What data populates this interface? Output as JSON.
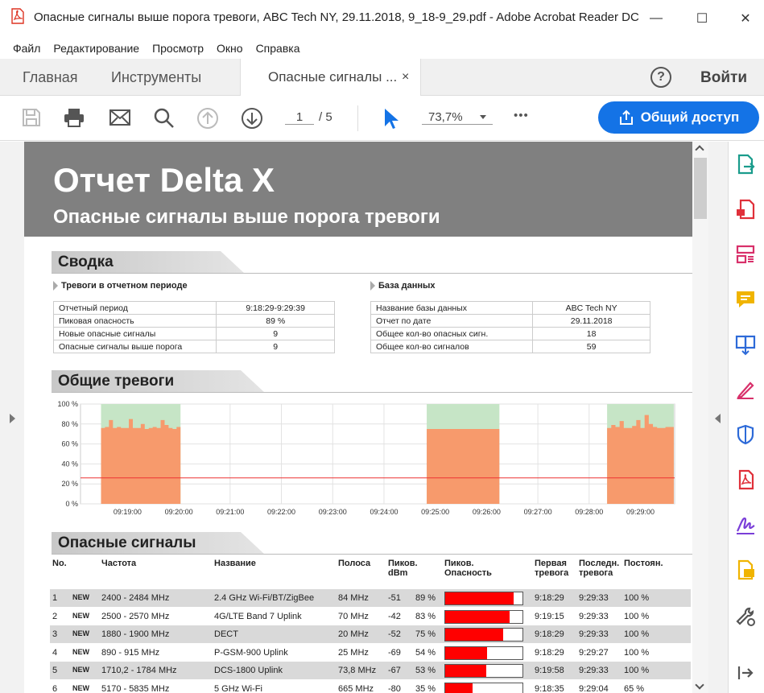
{
  "window": {
    "title": "Опасные сигналы выше порога тревоги, ABC Tech NY, 29.11.2018, 9_18-9_29.pdf - Adobe Acrobat Reader DC",
    "minimize": "—",
    "maximize": "☐",
    "close": "✕"
  },
  "menu": [
    "Файл",
    "Редактирование",
    "Просмотр",
    "Окно",
    "Справка"
  ],
  "tabs": {
    "home": "Главная",
    "tools": "Инструменты",
    "doc": "Опасные сигналы ...",
    "doc_close": "×",
    "help": "?",
    "signin": "Войти"
  },
  "toolbar": {
    "page_current": "1",
    "page_total": "/ 5",
    "zoom": "73,7%",
    "more": "•••",
    "share": "Общий доступ"
  },
  "report": {
    "title": "Отчет Delta X",
    "subtitle": "Опасные сигналы выше порога тревоги",
    "summary_title": "Сводка",
    "alarms_sub": "Тревоги в отчетном периоде",
    "db_sub": "База данных",
    "alarms_rows": [
      {
        "label": "Отчетный период",
        "value": "9:18:29-9:29:39"
      },
      {
        "label": "Пиковая опасность",
        "value": "89 %"
      },
      {
        "label": "Новые опасные сигналы",
        "value": "9"
      },
      {
        "label": "Опасные сигналы выше порога",
        "value": "9"
      }
    ],
    "db_rows": [
      {
        "label": "Название базы данных",
        "value": "ABC Tech NY"
      },
      {
        "label": "Отчет по дате",
        "value": "29.11.2018"
      },
      {
        "label": "Общее кол-во опасных сигн.",
        "value": "18"
      },
      {
        "label": "Общее кол-во сигналов",
        "value": "59"
      }
    ],
    "general_title": "Общие тревоги",
    "signals_title": "Опасные сигналы",
    "sig_headers": {
      "no": "No.",
      "freq": "Частота",
      "name": "Название",
      "band": "Полоса",
      "peak_dbm": "Пиков. dBm",
      "peak_danger": "Пиков. Опасность",
      "first": "Первая тревога",
      "last": "Последн. тревога",
      "const": "Постоян."
    },
    "signals": [
      {
        "no": "1",
        "new": "NEW",
        "freq": "2400 - 2484 MHz",
        "name": "2.4 GHz Wi-Fi/BT/ZigBee",
        "band": "84 MHz",
        "dbm": "-51",
        "pct": "89 %",
        "level": 89,
        "first": "9:18:29",
        "last": "9:29:33",
        "const": "100 %"
      },
      {
        "no": "2",
        "new": "NEW",
        "freq": "2500 - 2570 MHz",
        "name": "4G/LTE Band 7 Uplink",
        "band": "70 MHz",
        "dbm": "-42",
        "pct": "83 %",
        "level": 83,
        "first": "9:19:15",
        "last": "9:29:33",
        "const": "100 %"
      },
      {
        "no": "3",
        "new": "NEW",
        "freq": "1880 - 1900 MHz",
        "name": "DECT",
        "band": "20 MHz",
        "dbm": "-52",
        "pct": "75 %",
        "level": 75,
        "first": "9:18:29",
        "last": "9:29:33",
        "const": "100 %"
      },
      {
        "no": "4",
        "new": "NEW",
        "freq": "890 - 915 MHz",
        "name": "P-GSM-900 Uplink",
        "band": "25 MHz",
        "dbm": "-69",
        "pct": "54 %",
        "level": 54,
        "first": "9:18:29",
        "last": "9:29:27",
        "const": "100 %"
      },
      {
        "no": "5",
        "new": "NEW",
        "freq": "1710,2 - 1784 MHz",
        "name": "DCS-1800 Uplink",
        "band": "73,8 MHz",
        "dbm": "-67",
        "pct": "53 %",
        "level": 53,
        "first": "9:19:58",
        "last": "9:29:33",
        "const": "100 %"
      },
      {
        "no": "6",
        "new": "NEW",
        "freq": "5170 - 5835 MHz",
        "name": "5 GHz Wi-Fi",
        "band": "665 MHz",
        "dbm": "-80",
        "pct": "35 %",
        "level": 35,
        "first": "9:18:35",
        "last": "9:29:04",
        "const": "65 %"
      }
    ]
  },
  "chart_data": {
    "type": "area",
    "title": "",
    "xlabel": "",
    "ylabel": "",
    "ylim": [
      0,
      100
    ],
    "y_ticks": [
      "0 %",
      "20 %",
      "40 %",
      "60 %",
      "80 %",
      "100 %"
    ],
    "x_ticks": [
      "09:19:00",
      "09:20:00",
      "09:21:00",
      "09:22:00",
      "09:23:00",
      "09:24:00",
      "09:25:00",
      "09:26:00",
      "09:27:00",
      "09:28:00",
      "09:29:00"
    ],
    "threshold": 26,
    "alarm_color": "#f79a6c",
    "alarm_zone_color": "#c6e5c6",
    "threshold_color": "#e33",
    "segments": [
      {
        "start": "09:18:29",
        "end": "09:20:02",
        "base": 75,
        "spikes": [
          76,
          77,
          84,
          76,
          77,
          76,
          76,
          85,
          76,
          76,
          80,
          75,
          76,
          77,
          76,
          84,
          79,
          76,
          75,
          77
        ]
      },
      {
        "start": "09:24:50",
        "end": "09:26:15",
        "base": 75,
        "spikes": [
          75
        ]
      },
      {
        "start": "09:28:21",
        "end": "09:29:39",
        "base": 75,
        "spikes": [
          76,
          79,
          77,
          83,
          76,
          76,
          78,
          84,
          76,
          89,
          80,
          77,
          76,
          76,
          77,
          77
        ]
      }
    ]
  }
}
